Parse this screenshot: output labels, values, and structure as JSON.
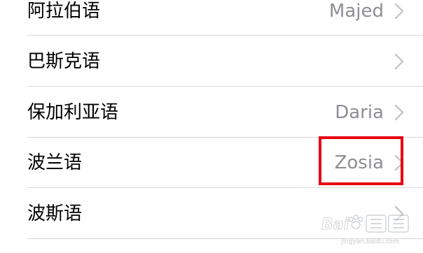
{
  "languages": {
    "items": [
      {
        "label": "阿拉伯语",
        "value": "Majed"
      },
      {
        "label": "巴斯克语",
        "value": ""
      },
      {
        "label": "保加利亚语",
        "value": "Daria"
      },
      {
        "label": "波兰语",
        "value": "Zosia"
      },
      {
        "label": "波斯语",
        "value": ""
      }
    ]
  },
  "colors": {
    "label_text": "#000000",
    "value_text": "#8e8e93",
    "chevron": "#c7c7cc",
    "divider": "#d9d9dc",
    "highlight": "#e60012"
  },
  "watermark": {
    "brand": "Bai百经验",
    "url": "jingyan.baidu.com"
  }
}
